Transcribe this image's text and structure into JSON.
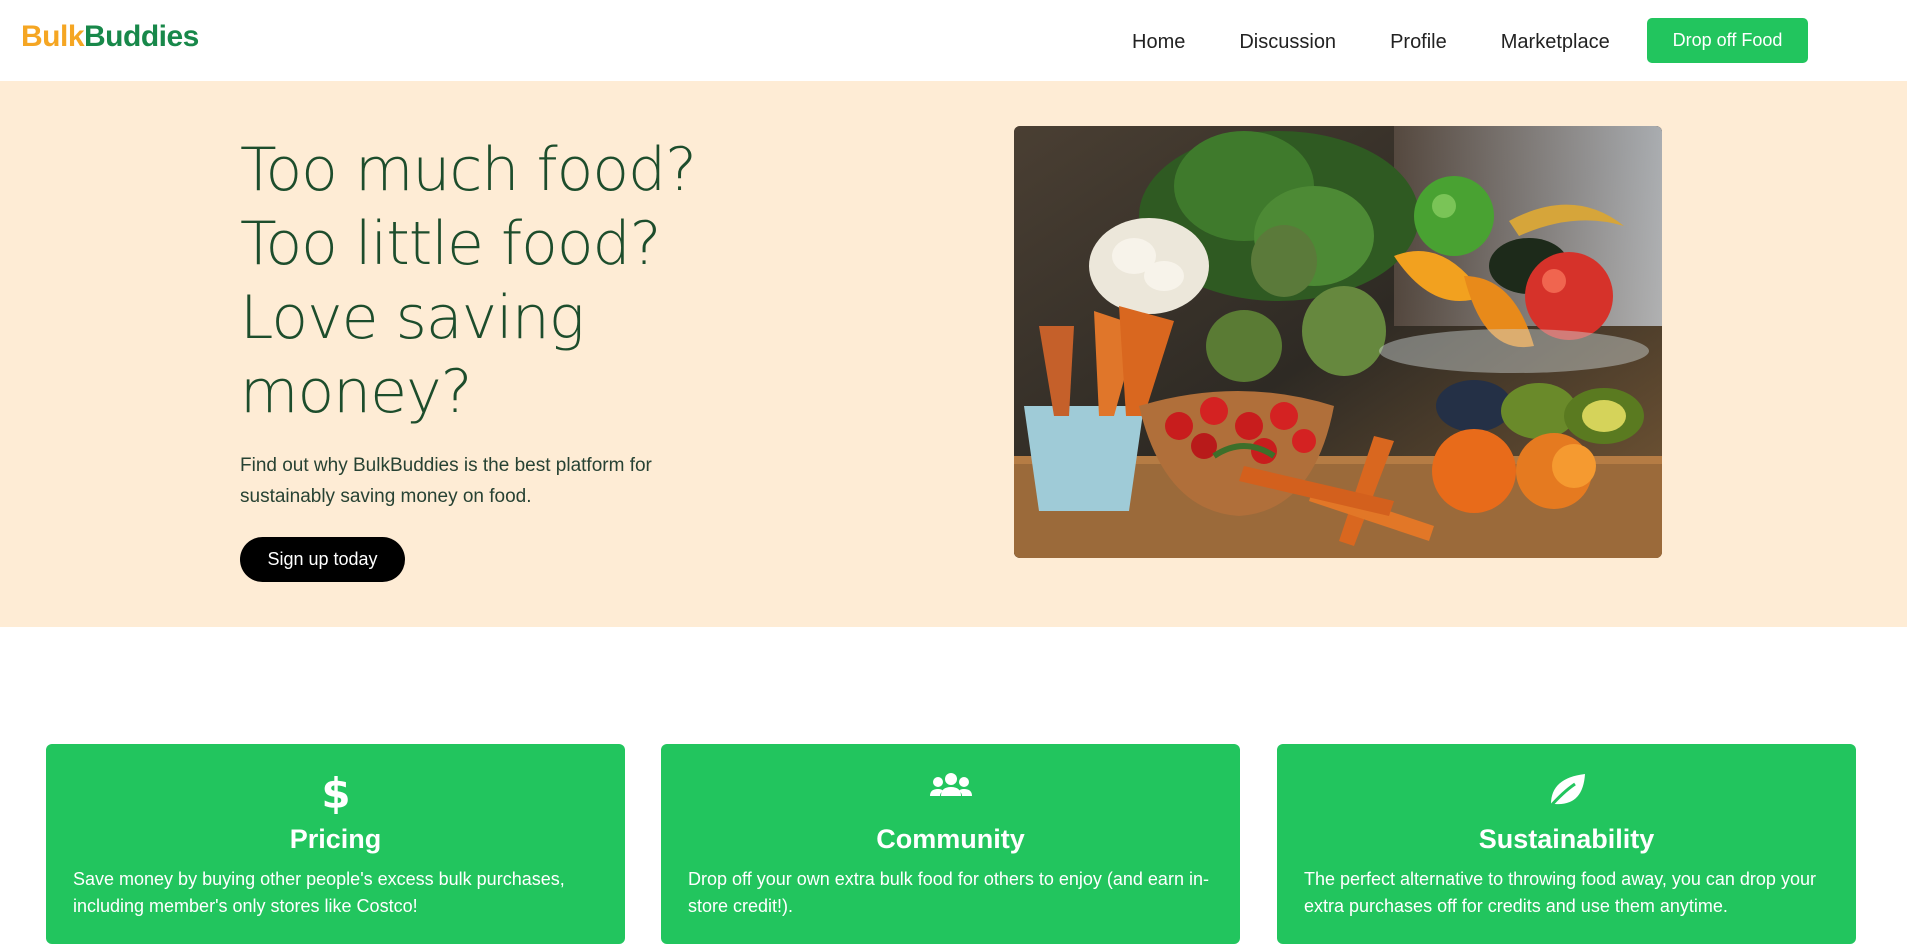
{
  "brand": {
    "part1": "Bulk",
    "part2": "Buddies"
  },
  "nav": {
    "items": [
      "Home",
      "Discussion",
      "Profile",
      "Marketplace"
    ],
    "cta": "Drop off Food"
  },
  "hero": {
    "title_lines": [
      "Too much food?",
      "Too little food?",
      "Love saving",
      "money?"
    ],
    "subtitle": "Find out why BulkBuddies is the best platform for sustainably saving money on food.",
    "signup": "Sign up today",
    "image": "fresh-vegetables-and-fruit-photo"
  },
  "features": [
    {
      "icon": "dollar-icon",
      "title": "Pricing",
      "desc": "Save money by buying other people's excess bulk purchases, including member's only stores like Costco!"
    },
    {
      "icon": "users-icon",
      "title": "Community",
      "desc": "Drop off your own extra bulk food for others to enjoy (and earn in-store credit!)."
    },
    {
      "icon": "leaf-icon",
      "title": "Sustainability",
      "desc": "The perfect alternative to throwing food away, you can drop your extra purchases off for credits and use them anytime."
    }
  ],
  "colors": {
    "accent": "#22c55e",
    "brand_orange": "#f5a623",
    "brand_green": "#18884a",
    "hero_bg": "#feecd5"
  }
}
